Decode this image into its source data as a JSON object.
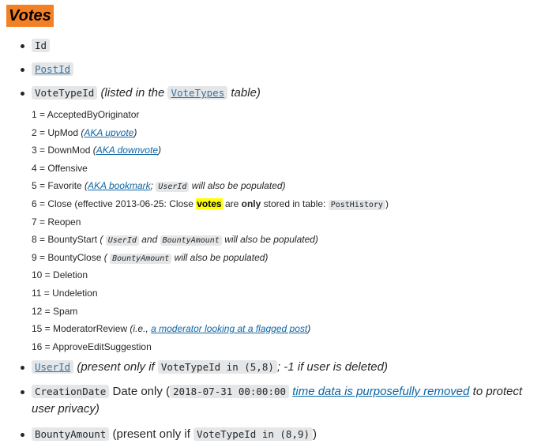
{
  "title": "Votes",
  "fields": {
    "id": {
      "code": "Id"
    },
    "post_id": {
      "code": "PostId"
    },
    "vote_type_id": {
      "code": "VoteTypeId",
      "desc_pre": "(listed in the",
      "link_code": "VoteTypes",
      "desc_post": "table)",
      "types": {
        "t1": "1 = AcceptedByOriginator",
        "t2": {
          "label": "2 = UpMod",
          "pre": "(",
          "link": "AKA upvote",
          "post": ")"
        },
        "t3": {
          "label": "3 = DownMod",
          "pre": "(",
          "link": "AKA downvote",
          "post": ")"
        },
        "t4": "4 = Offensive",
        "t5": {
          "label": "5 = Favorite",
          "pre": "(",
          "link": "AKA bookmark",
          "sep": ";",
          "code": "UserId",
          "post": "will also be populated)"
        },
        "t6": {
          "label": "6 = Close (effective 2013-06-25: Close",
          "highlight": "votes",
          "mid": "are",
          "bold": "only",
          "rest": "stored in table:",
          "code": "PostHistory",
          "post": ")"
        },
        "t7": "7 = Reopen",
        "t8": {
          "label": "8 = BountyStart",
          "pre": "(",
          "code1": "UserId",
          "and": "and",
          "code2": "BountyAmount",
          "post": "will also be populated)"
        },
        "t9": {
          "label": "9 = BountyClose",
          "pre": "(",
          "code": "BountyAmount",
          "post": "will also be populated)"
        },
        "t10": "10 = Deletion",
        "t11": "11 = Undeletion",
        "t12": "12 = Spam",
        "t15": {
          "label": "15 = ModeratorReview",
          "pre": "(i.e.,",
          "link": "a moderator looking at a flagged post",
          "post": ")"
        },
        "t16": "16 = ApproveEditSuggestion"
      }
    },
    "user_id": {
      "code": "UserId",
      "pre": "(present only if",
      "cond": "VoteTypeId in (5,8)",
      "post": "; -1 if user is deleted)"
    },
    "creation_date": {
      "code": "CreationDate",
      "text": "Date only (",
      "example": "2018-07-31 00:00:00",
      "link": "time data is purposefully removed",
      "post_line1": "to protect",
      "post_line2": "user privacy)"
    },
    "bounty_amount": {
      "code": "BountyAmount",
      "pre": "(present only if",
      "cond": "VoteTypeId in (8,9)",
      "post": ")"
    }
  },
  "colors": {
    "title_bg": "#f48024",
    "link": "#0c65a5",
    "code_bg": "#e4e6e8",
    "highlight": "#ffff00"
  }
}
